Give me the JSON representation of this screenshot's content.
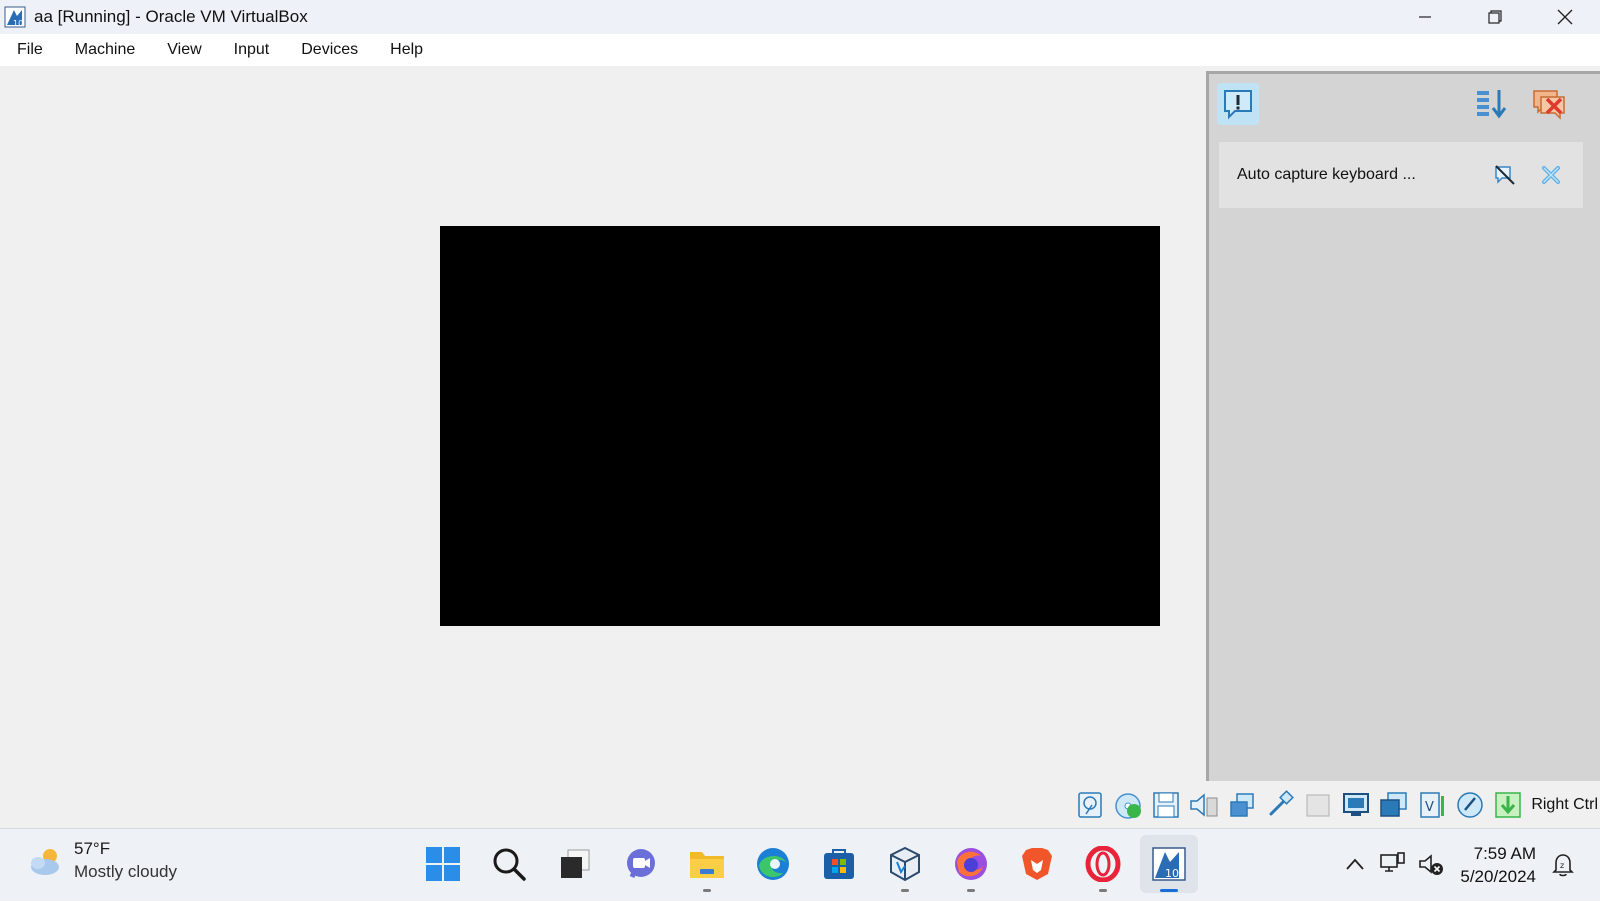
{
  "window": {
    "title": "aa [Running] - Oracle VM VirtualBox",
    "controls": [
      "minimize",
      "restore",
      "close"
    ]
  },
  "menu": {
    "items": [
      {
        "label": "File"
      },
      {
        "label": "Machine"
      },
      {
        "label": "View"
      },
      {
        "label": "Input"
      },
      {
        "label": "Devices"
      },
      {
        "label": "Help"
      }
    ]
  },
  "vm": {
    "screen_color": "#000000"
  },
  "notification_center": {
    "toolbar": {
      "messages_icon": "exclamation-bubble-icon",
      "sort_icon": "sort-down-icon",
      "dismiss_all_icon": "dismiss-all-icon"
    },
    "items": [
      {
        "text": "Auto capture keyboard ..."
      }
    ]
  },
  "statusbar": {
    "icons": [
      "hard-disk-icon",
      "optical-drive-icon",
      "floppy-icon",
      "audio-icon",
      "network-icon",
      "usb-icon",
      "shared-folder-icon",
      "display-icon",
      "recording-icon",
      "virtualization-icon",
      "mouse-integration-icon",
      "keyboard-capture-icon"
    ],
    "host_key": "Right Ctrl"
  },
  "taskbar": {
    "weather": {
      "temp": "57°F",
      "description": "Mostly cloudy"
    },
    "apps": [
      "windows-start-icon",
      "search-icon",
      "task-view-icon",
      "teams-chat-icon",
      "file-explorer-icon",
      "edge-icon",
      "microsoft-store-icon",
      "virtualbox-icon",
      "firefox-icon",
      "brave-icon",
      "opera-icon",
      "vm-window-icon"
    ],
    "clock": {
      "time": "7:59 AM",
      "date": "5/20/2024"
    }
  },
  "colors": {
    "accent": "#1a6fd6",
    "panel_bg": "#d4d4d4",
    "taskbar_bg": "#eef1f6"
  }
}
